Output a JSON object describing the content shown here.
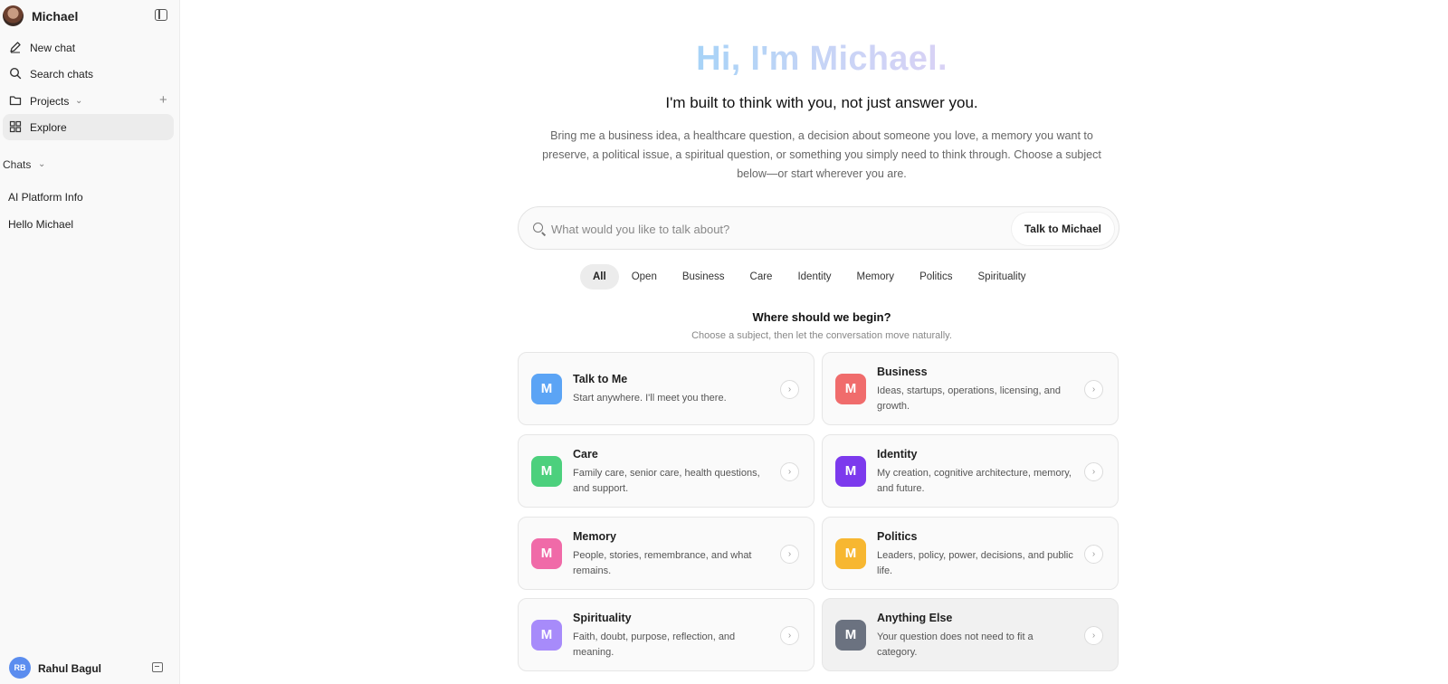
{
  "sidebar": {
    "title": "Michael",
    "nav": {
      "new_chat": "New chat",
      "search_chats": "Search chats",
      "projects": "Projects",
      "explore": "Explore"
    },
    "chats_label": "Chats",
    "chats": [
      "AI Platform Info",
      "Hello Michael"
    ],
    "user": {
      "initials": "RB",
      "name": "Rahul Bagul"
    }
  },
  "hero": {
    "title": "Hi, I'm Michael.",
    "subtitle": "I'm built to think with you, not just answer you.",
    "description": "Bring me a business idea, a healthcare question, a decision about someone you love, a memory you want to preserve, a political issue, a spiritual question, or something you simply need to think through. Choose a subject below—or start wherever you are."
  },
  "search": {
    "placeholder": "What would you like to talk about?",
    "button": "Talk to Michael"
  },
  "filters": [
    "All",
    "Open",
    "Business",
    "Care",
    "Identity",
    "Memory",
    "Politics",
    "Spirituality"
  ],
  "begin": {
    "title": "Where should we begin?",
    "subtitle": "Choose a subject, then let the conversation move naturally."
  },
  "cards": [
    {
      "letter": "M",
      "title": "Talk to Me",
      "desc": "Start anywhere. I'll meet you there.",
      "color": "#5ba4f5"
    },
    {
      "letter": "M",
      "title": "Business",
      "desc": "Ideas, startups, operations, licensing, and growth.",
      "color": "#f06c6c"
    },
    {
      "letter": "M",
      "title": "Care",
      "desc": "Family care, senior care, health questions, and support.",
      "color": "#4cd07d"
    },
    {
      "letter": "M",
      "title": "Identity",
      "desc": "My creation, cognitive architecture, memory, and future.",
      "color": "#7c3aed"
    },
    {
      "letter": "M",
      "title": "Memory",
      "desc": "People, stories, remembrance, and what remains.",
      "color": "#f06aa8"
    },
    {
      "letter": "M",
      "title": "Politics",
      "desc": "Leaders, policy, power, decisions, and public life.",
      "color": "#f7b731"
    },
    {
      "letter": "M",
      "title": "Spirituality",
      "desc": "Faith, doubt, purpose, reflection, and meaning.",
      "color": "#a78bfa"
    },
    {
      "letter": "M",
      "title": "Anything Else",
      "desc": "Your question does not need to fit a category.",
      "color": "#6b7280"
    }
  ]
}
